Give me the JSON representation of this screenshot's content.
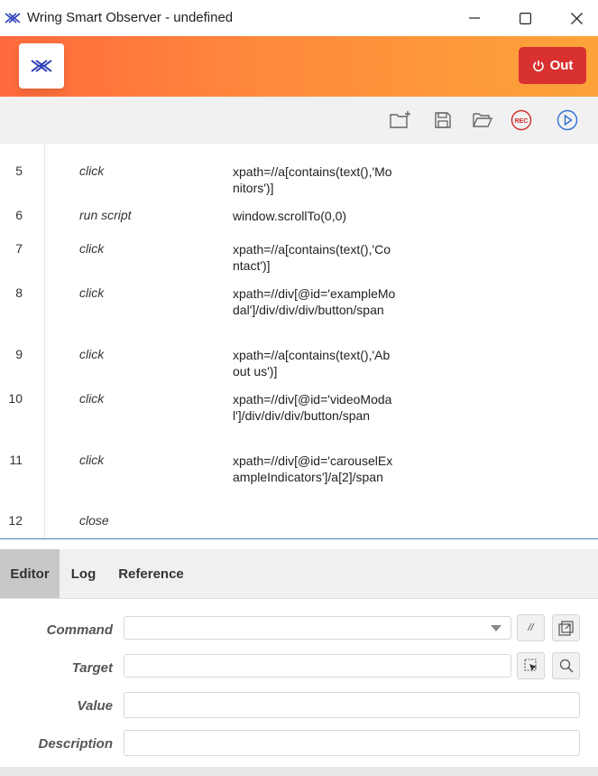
{
  "window": {
    "title": "Wring Smart Observer - undefined"
  },
  "header": {
    "out_label": "Out",
    "accent_colors": [
      "#ff6a3d",
      "#fca33a"
    ],
    "out_color": "#d93030"
  },
  "toolbar": {
    "icons": [
      "new-folder-icon",
      "save-icon",
      "open-folder-icon",
      "record-icon",
      "play-icon"
    ],
    "rec_label": "REC"
  },
  "commands": [
    {
      "num": "5",
      "command": "click",
      "target": "xpath=//a[contains(text(),'Monitors')]"
    },
    {
      "num": "6",
      "command": "run script",
      "target": "window.scrollTo(0,0)"
    },
    {
      "num": "7",
      "command": "click",
      "target": "xpath=//a[contains(text(),'Contact')]"
    },
    {
      "num": "8",
      "command": "click",
      "target": "xpath=//div[@id='exampleModal']/div/div/div/button/span"
    },
    {
      "num": "9",
      "command": "click",
      "target": "xpath=//a[contains(text(),'About us')]"
    },
    {
      "num": "10",
      "command": "click",
      "target": "xpath=//div[@id='videoModal']/div/div/div/button/span"
    },
    {
      "num": "11",
      "command": "click",
      "target": "xpath=//div[@id='carouselExampleIndicators']/a[2]/span"
    },
    {
      "num": "12",
      "command": "close",
      "target": ""
    }
  ],
  "tabs": [
    {
      "label": "Editor",
      "active": true
    },
    {
      "label": "Log",
      "active": false
    },
    {
      "label": "Reference",
      "active": false
    }
  ],
  "form": {
    "command_label": "Command",
    "target_label": "Target",
    "value_label": "Value",
    "description_label": "Description",
    "command_value": "",
    "target_value": "",
    "value_value": "",
    "description_value": "",
    "comment_btn": "//"
  }
}
